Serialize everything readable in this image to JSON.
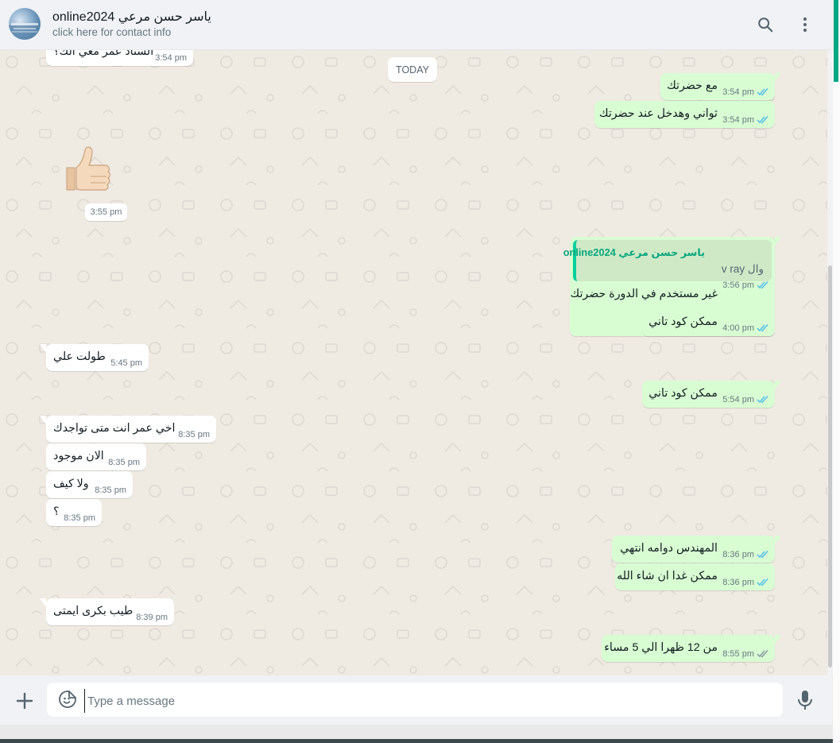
{
  "header": {
    "contact_name": "online2024 ياسر حسن مرعي",
    "contact_sub": "click here for contact info"
  },
  "icons": {
    "search": "search-icon",
    "menu": "kebab-menu-icon",
    "attach": "plus-icon",
    "emoji": "sticker-smiley-icon",
    "mic": "microphone-icon",
    "ticks": "double-check-read-icon",
    "sticker": "thumbs-up-sticker"
  },
  "colors": {
    "outgoing_bubble": "#d9fdd3",
    "incoming_bubble": "#ffffff",
    "read_ticks": "#53bdeb",
    "sent_ticks": "#8696a0",
    "accent": "#00a884"
  },
  "chat": {
    "top_partial": {
      "text": "الستاد عمر معي الك؟",
      "time": "3:54 pm"
    },
    "date_badge": "TODAY",
    "sticker_time": "3:55 pm",
    "reply": {
      "author": "ياسر حسن مرعي online2024",
      "quoted_text": "وال v ray",
      "text": "غير مستخدم في الدورة حضرتك",
      "time": "3:56 pm"
    },
    "messages": [
      {
        "dir": "out",
        "text": "مع حضرتك",
        "time": "3:54 pm",
        "status": "read"
      },
      {
        "dir": "out",
        "text": "ثواني وهدخل عند حضرتك",
        "time": "3:54 pm",
        "status": "read"
      },
      {
        "dir": "out",
        "text": "ممكن كود تاني",
        "time": "4:00 pm",
        "status": "read"
      },
      {
        "dir": "in",
        "text": "طولت علي",
        "time": "5:45 pm"
      },
      {
        "dir": "out",
        "text": "ممكن كود تاني",
        "time": "5:54 pm",
        "status": "read"
      },
      {
        "dir": "in",
        "text": "اخي عمر انت متى تواجدك",
        "time": "8:35 pm"
      },
      {
        "dir": "in",
        "text": "الان موجود",
        "time": "8:35 pm"
      },
      {
        "dir": "in",
        "text": "ولا كيف",
        "time": "8:35 pm"
      },
      {
        "dir": "in",
        "text": "؟",
        "time": "8:35 pm"
      },
      {
        "dir": "out",
        "text": "المهندس دوامه انتهي",
        "time": "8:36 pm",
        "status": "read"
      },
      {
        "dir": "out",
        "text": "ممكن غدا ان شاء الله",
        "time": "8:36 pm",
        "status": "read"
      },
      {
        "dir": "in",
        "text": "طيب بكرى ايمتى",
        "time": "8:39 pm"
      },
      {
        "dir": "out",
        "text": "من 12 ظهرا الي 5 مساء",
        "time": "8:55 pm",
        "status": "sent"
      }
    ]
  },
  "composer": {
    "placeholder": "Type a message"
  }
}
